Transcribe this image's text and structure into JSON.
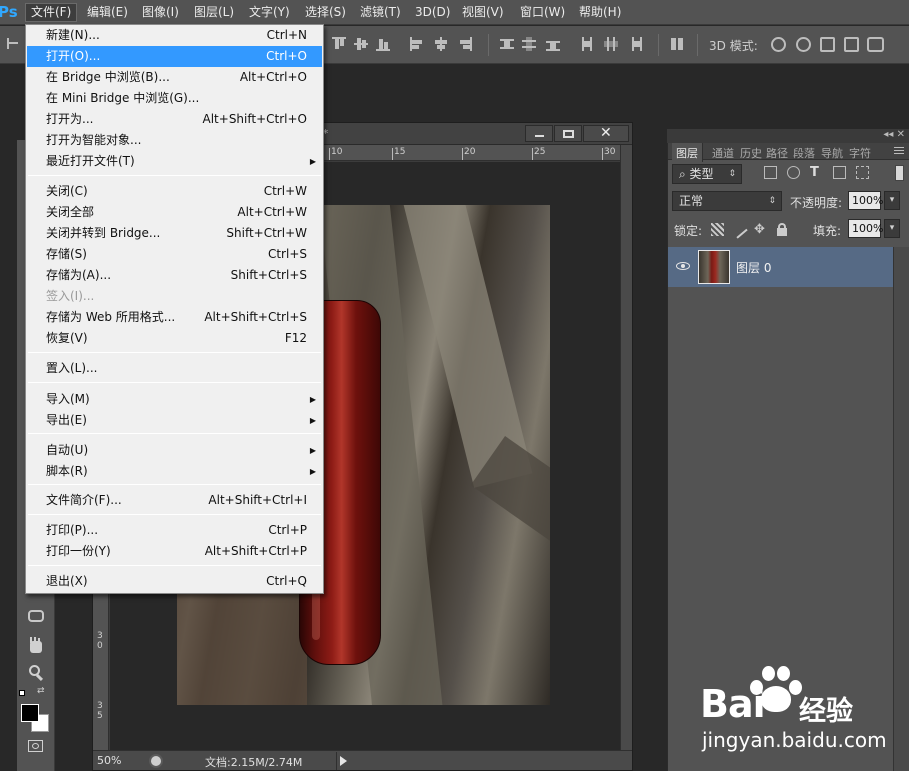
{
  "app": {
    "logo": "Ps"
  },
  "menubar": {
    "items": [
      "文件(F)",
      "编辑(E)",
      "图像(I)",
      "图层(L)",
      "文字(Y)",
      "选择(S)",
      "滤镜(T)",
      "3D(D)",
      "视图(V)",
      "窗口(W)",
      "帮助(H)"
    ],
    "active_index": 0
  },
  "options_bar": {
    "mode_3d_label": "3D 模式:"
  },
  "file_menu": {
    "items": [
      {
        "label": "新建(N)...",
        "shortcut": "Ctrl+N"
      },
      {
        "label": "打开(O)...",
        "shortcut": "Ctrl+O",
        "highlighted": true
      },
      {
        "label": "在 Bridge 中浏览(B)...",
        "shortcut": "Alt+Ctrl+O"
      },
      {
        "label": "在 Mini Bridge 中浏览(G)...",
        "shortcut": ""
      },
      {
        "label": "打开为...",
        "shortcut": "Alt+Shift+Ctrl+O"
      },
      {
        "label": "打开为智能对象...",
        "shortcut": ""
      },
      {
        "label": "最近打开文件(T)",
        "shortcut": "",
        "submenu": true
      },
      {
        "label": "关闭(C)",
        "shortcut": "Ctrl+W"
      },
      {
        "label": "关闭全部",
        "shortcut": "Alt+Ctrl+W"
      },
      {
        "label": "关闭并转到 Bridge...",
        "shortcut": "Shift+Ctrl+W"
      },
      {
        "label": "存储(S)",
        "shortcut": "Ctrl+S"
      },
      {
        "label": "存储为(A)...",
        "shortcut": "Shift+Ctrl+S"
      },
      {
        "label": "签入(I)...",
        "shortcut": "",
        "disabled": true
      },
      {
        "label": "存储为 Web 所用格式...",
        "shortcut": "Alt+Shift+Ctrl+S"
      },
      {
        "label": "恢复(V)",
        "shortcut": "F12"
      },
      {
        "label": "置入(L)...",
        "shortcut": ""
      },
      {
        "label": "导入(M)",
        "shortcut": "",
        "submenu": true
      },
      {
        "label": "导出(E)",
        "shortcut": "",
        "submenu": true
      },
      {
        "label": "自动(U)",
        "shortcut": "",
        "submenu": true
      },
      {
        "label": "脚本(R)",
        "shortcut": "",
        "submenu": true
      },
      {
        "label": "文件简介(F)...",
        "shortcut": "Alt+Shift+Ctrl+I"
      },
      {
        "label": "打印(P)...",
        "shortcut": "Ctrl+P"
      },
      {
        "label": "打印一份(Y)",
        "shortcut": "Alt+Shift+Ctrl+P"
      },
      {
        "label": "退出(X)",
        "shortcut": "Ctrl+Q"
      }
    ]
  },
  "document": {
    "title_suffix": ") *",
    "ruler_top": [
      "10",
      "15",
      "20",
      "25",
      "30"
    ],
    "ruler_left": [
      "3\n0",
      "3\n5"
    ],
    "zoom": "50%",
    "info": "文档:2.15M/2.74M"
  },
  "layers_panel": {
    "tabs": [
      "图层",
      "通道",
      "历史",
      "路径",
      "段落",
      "导航",
      "字符"
    ],
    "filter_kind": "类型",
    "blend_mode": "正常",
    "opacity_label": "不透明度:",
    "opacity_value": "100%",
    "lock_label": "锁定:",
    "fill_label": "填充:",
    "fill_value": "100%",
    "layers": [
      {
        "name": "图层 0",
        "selected": true,
        "visible": true
      }
    ]
  },
  "watermark": {
    "brand_bai": "Bai",
    "brand_du": "du",
    "brand_jingyan": "经验",
    "url": "jingyan.baidu.com"
  },
  "colors": {
    "menu_highlight": "#3399ff",
    "layer_selected": "#566a85",
    "bottle_cap_ring": "#e1d52a"
  }
}
